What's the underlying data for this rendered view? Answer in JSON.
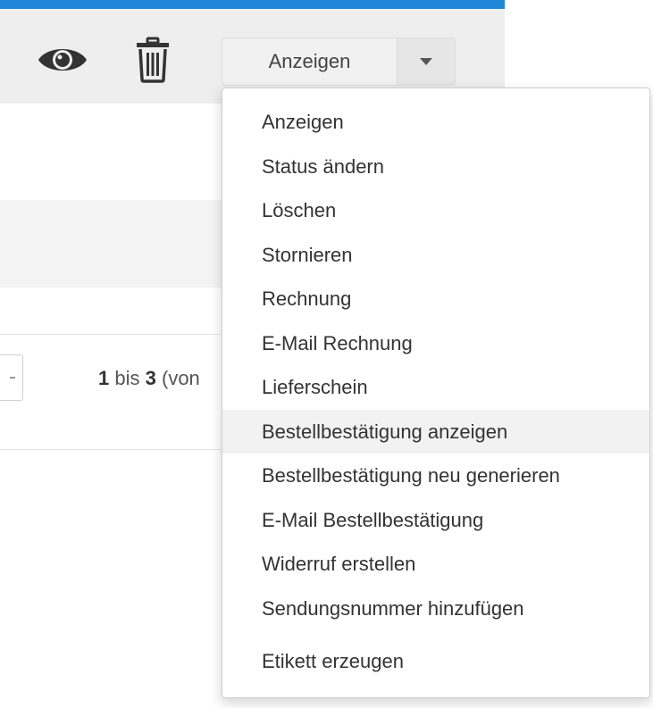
{
  "toolbar": {
    "accent_color": "#1f87d7",
    "view_icon": "eye-icon",
    "delete_icon": "trash-icon",
    "action_button_label": "Anzeigen",
    "dropdown_toggle_icon": "caret-down-icon"
  },
  "dropdown_menu": {
    "items": [
      {
        "label": "Anzeigen"
      },
      {
        "label": "Status ändern"
      },
      {
        "label": "Löschen"
      },
      {
        "label": "Stornieren"
      },
      {
        "label": "Rechnung"
      },
      {
        "label": "E-Mail Rechnung"
      },
      {
        "label": "Lieferschein"
      },
      {
        "label": "Bestellbestätigung anzeigen",
        "highlighted": true
      },
      {
        "label": "Bestellbestätigung neu generieren"
      },
      {
        "label": "E-Mail Bestellbestätigung"
      },
      {
        "label": "Widerruf erstellen"
      },
      {
        "label": "Sendungsnummer hinzufügen"
      },
      {
        "label": "Etikett erzeugen"
      }
    ]
  },
  "pagination": {
    "from": "1",
    "to_label": "bis",
    "to": "3",
    "of_label": "(von"
  }
}
